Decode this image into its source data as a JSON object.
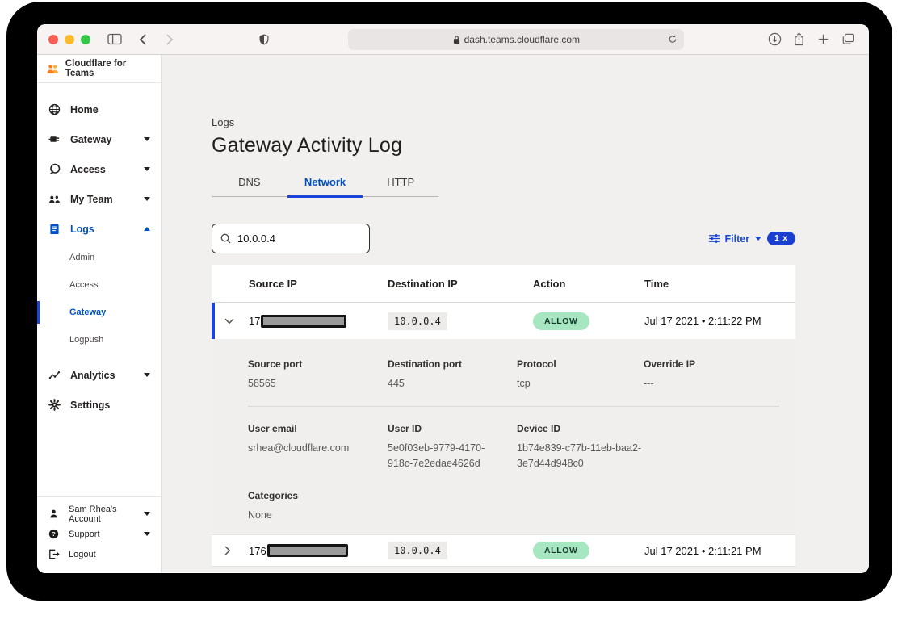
{
  "colors": {
    "accent_blue": "#0051c3",
    "badge_blue": "#1b3fd1",
    "allow_bg": "#a6e6c1",
    "allow_text": "#15382a",
    "brand_orange": "#f6821f",
    "traffic_red": "#f95f56",
    "traffic_yellow": "#fcbb2f",
    "traffic_green": "#35c748"
  },
  "browser": {
    "url": "dash.teams.cloudflare.com"
  },
  "sidebar": {
    "brand": "Cloudflare for Teams",
    "items": [
      {
        "label": "Home",
        "icon": "globe-icon"
      },
      {
        "label": "Gateway",
        "icon": "gateway-icon"
      },
      {
        "label": "Access",
        "icon": "access-icon"
      },
      {
        "label": "My Team",
        "icon": "team-icon"
      },
      {
        "label": "Logs",
        "icon": "logs-icon"
      },
      {
        "label": "Analytics",
        "icon": "analytics-icon"
      },
      {
        "label": "Settings",
        "icon": "settings-icon"
      }
    ],
    "logs_subitems": [
      {
        "label": "Admin"
      },
      {
        "label": "Access"
      },
      {
        "label": "Gateway"
      },
      {
        "label": "Logpush"
      }
    ],
    "footer": [
      {
        "label": "Sam Rhea's Account",
        "icon": "person-icon"
      },
      {
        "label": "Support",
        "icon": "help-icon"
      },
      {
        "label": "Logout",
        "icon": "logout-icon"
      }
    ]
  },
  "main": {
    "breadcrumb": "Logs",
    "title": "Gateway Activity Log",
    "tabs": [
      {
        "label": "DNS"
      },
      {
        "label": "Network"
      },
      {
        "label": "HTTP"
      }
    ],
    "search": {
      "value": "10.0.0.4"
    },
    "filter": {
      "label": "Filter",
      "badge": "1 x"
    },
    "table": {
      "headers": [
        "Source IP",
        "Destination IP",
        "Action",
        "Time"
      ],
      "rows": [
        {
          "source_ip_prefix": "17",
          "dest_ip": "10.0.0.4",
          "action": "ALLOW",
          "time": "Jul 17 2021 • 2:11:22 PM"
        },
        {
          "source_ip_prefix": "176",
          "dest_ip": "10.0.0.4",
          "action": "ALLOW",
          "time": "Jul 17 2021 • 2:11:21 PM"
        }
      ],
      "details": {
        "source_port_label": "Source port",
        "source_port": "58565",
        "dest_port_label": "Destination port",
        "dest_port": "445",
        "protocol_label": "Protocol",
        "protocol": "tcp",
        "override_ip_label": "Override IP",
        "override_ip": "---",
        "user_email_label": "User email",
        "user_email": "srhea@cloudflare.com",
        "user_id_label": "User ID",
        "user_id": "5e0f03eb-9779-4170-918c-7e2edae4626d",
        "device_id_label": "Device ID",
        "device_id": "1b74e839-c77b-11eb-baa2-3e7d44d948c0",
        "categories_label": "Categories",
        "categories": "None"
      }
    }
  }
}
